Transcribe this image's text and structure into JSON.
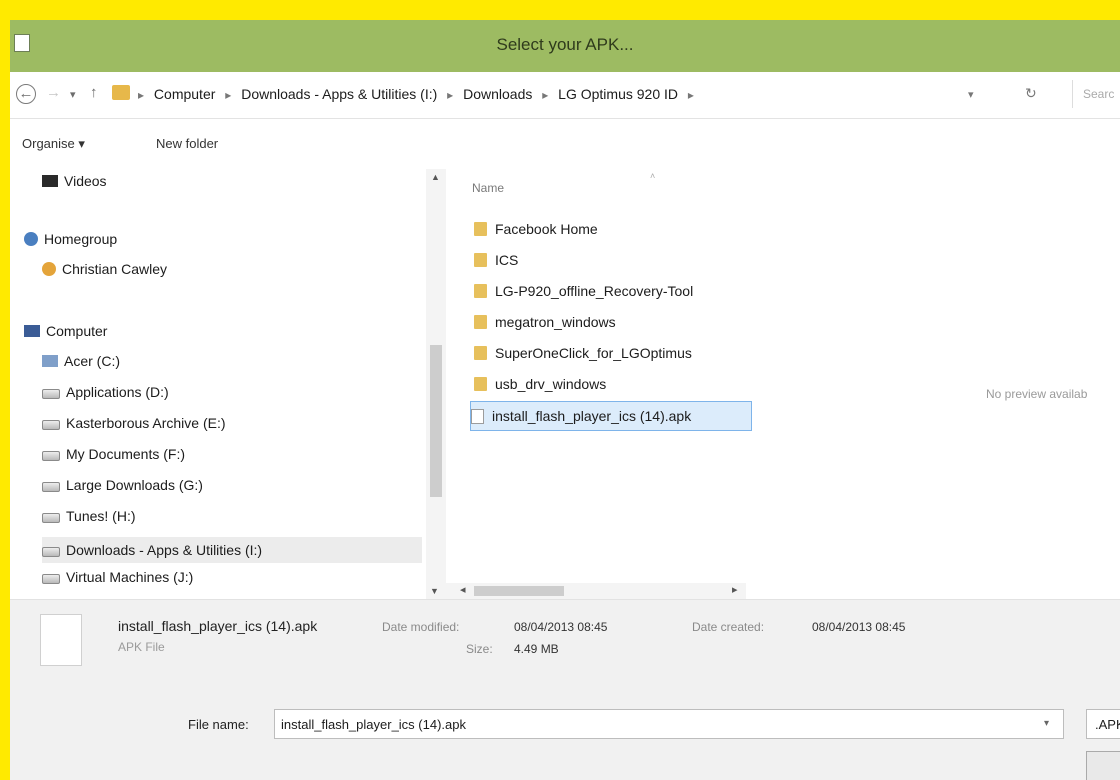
{
  "window": {
    "title": "Select your APK..."
  },
  "address": {
    "crumbs": [
      "Computer",
      "Downloads - Apps & Utilities (I:)",
      "Downloads",
      "LG Optimus 920 ID"
    ],
    "separator": "▸",
    "search_placeholder": "Searc"
  },
  "toolbar": {
    "organise_label": "Organise ▾",
    "new_folder_label": "New folder"
  },
  "nav": {
    "videos": "Videos",
    "homegroup": "Homegroup",
    "user": "Christian Cawley",
    "computer": "Computer",
    "drives": [
      "Acer (C:)",
      "Applications (D:)",
      "Kasterborous Archive (E:)",
      "My Documents (F:)",
      "Large Downloads (G:)",
      "Tunes! (H:)",
      "Downloads - Apps & Utilities (I:)",
      "Virtual Machines (J:)"
    ]
  },
  "files": {
    "column_name": "Name",
    "items": [
      {
        "name": "Facebook Home",
        "kind": "folder"
      },
      {
        "name": "ICS",
        "kind": "folder"
      },
      {
        "name": "LG-P920_offline_Recovery-Tool",
        "kind": "folder"
      },
      {
        "name": "megatron_windows",
        "kind": "folder"
      },
      {
        "name": "SuperOneClick_for_LGOptimus",
        "kind": "folder"
      },
      {
        "name": "usb_drv_windows",
        "kind": "folder"
      },
      {
        "name": "install_flash_player_ics (14).apk",
        "kind": "apk"
      }
    ],
    "no_preview": "No preview availab"
  },
  "details": {
    "name": "install_flash_player_ics (14).apk",
    "type": "APK File",
    "modified_label": "Date modified:",
    "modified_value": "08/04/2013 08:45",
    "created_label": "Date created:",
    "created_value": "08/04/2013 08:45",
    "size_label": "Size:",
    "size_value": "4.49 MB"
  },
  "filename": {
    "label": "File name:",
    "value": "install_flash_player_ics (14).apk",
    "type_value": ".APK"
  },
  "colors": {
    "titlebar": "#9dbb62",
    "border": "#ffea00",
    "selection": "#dcecfb"
  }
}
